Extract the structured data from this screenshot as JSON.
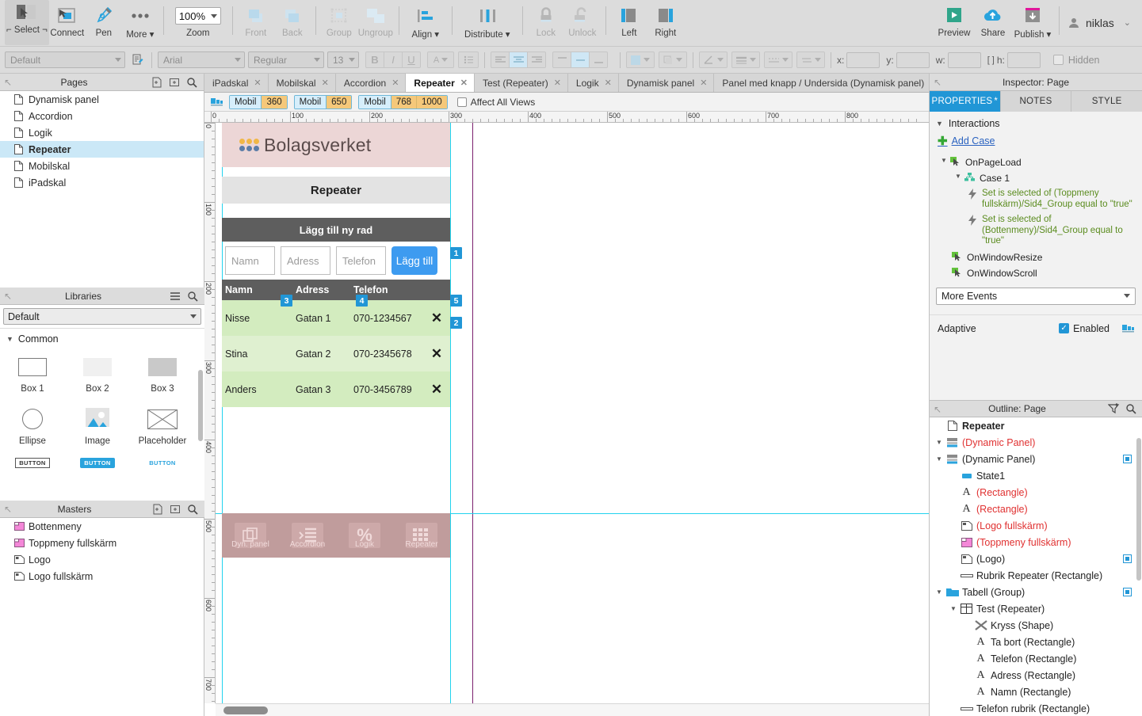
{
  "toolbar": {
    "items": [
      {
        "label": "Select",
        "name": "select-tool",
        "enabled": true
      },
      {
        "label": "Connect",
        "name": "connect-tool",
        "enabled": true
      },
      {
        "label": "Pen",
        "name": "pen-tool",
        "enabled": true
      },
      {
        "label": "More ▾",
        "name": "more-tool",
        "enabled": true
      }
    ],
    "zoom_value": "100%",
    "zoom_label": "Zoom",
    "order": [
      {
        "label": "Front",
        "name": "bring-front-button",
        "enabled": false
      },
      {
        "label": "Back",
        "name": "send-back-button",
        "enabled": false
      }
    ],
    "grouping": [
      {
        "label": "Group",
        "name": "group-button",
        "enabled": false
      },
      {
        "label": "Ungroup",
        "name": "ungroup-button",
        "enabled": false
      }
    ],
    "arrange": [
      {
        "label": "Align ▾",
        "name": "align-button",
        "enabled": true
      },
      {
        "label": "Distribute ▾",
        "name": "distribute-button",
        "enabled": true
      }
    ],
    "locking": [
      {
        "label": "Lock",
        "name": "lock-button",
        "enabled": false
      },
      {
        "label": "Unlock",
        "name": "unlock-button",
        "enabled": false
      }
    ],
    "pinning": [
      {
        "label": "Left",
        "name": "pin-left-button",
        "enabled": true
      },
      {
        "label": "Right",
        "name": "pin-right-button",
        "enabled": true
      }
    ],
    "publish": [
      {
        "label": "Preview",
        "name": "preview-button"
      },
      {
        "label": "Share",
        "name": "share-button"
      },
      {
        "label": "Publish ▾",
        "name": "publish-button"
      }
    ],
    "account": "niklas"
  },
  "formatbar": {
    "style": "Default",
    "font": "Arial",
    "weight": "Regular",
    "size": "13",
    "x_label": "x:",
    "y_label": "y:",
    "w_label": "w:",
    "h_label": "h:",
    "x_value": "",
    "y_value": "",
    "w_value": "",
    "h_value": "",
    "hidden_label": "Hidden"
  },
  "pages": {
    "title": "Pages",
    "items": [
      {
        "label": "Dynamisk panel",
        "selected": false
      },
      {
        "label": "Accordion",
        "selected": false
      },
      {
        "label": "Logik",
        "selected": false
      },
      {
        "label": "Repeater",
        "selected": true
      },
      {
        "label": "Mobilskal",
        "selected": false
      },
      {
        "label": "iPadskal",
        "selected": false
      }
    ]
  },
  "libraries": {
    "title": "Libraries",
    "selected": "Default",
    "category": "Common",
    "widgets": [
      {
        "label": "Box 1",
        "icon": "box-outline-icon"
      },
      {
        "label": "Box 2",
        "icon": "box-light-icon"
      },
      {
        "label": "Box 3",
        "icon": "box-grey-icon"
      },
      {
        "label": "Ellipse",
        "icon": "ellipse-icon"
      },
      {
        "label": "Image",
        "icon": "image-icon"
      },
      {
        "label": "Placeholder",
        "icon": "placeholder-icon"
      },
      {
        "label": "BUTTON",
        "icon": "button-outline-icon"
      },
      {
        "label": "BUTTON",
        "icon": "button-filled-icon"
      },
      {
        "label": "BUTTON",
        "icon": "button-link-icon"
      }
    ]
  },
  "masters": {
    "title": "Masters",
    "items": [
      {
        "label": "Bottenmeny",
        "icon": "master-pink-icon"
      },
      {
        "label": "Toppmeny fullskärm",
        "icon": "master-pink-icon"
      },
      {
        "label": "Logo",
        "icon": "master-grey-icon"
      },
      {
        "label": "Logo fullskärm",
        "icon": "master-grey-icon"
      }
    ]
  },
  "tabs": [
    {
      "label": "iPadskal",
      "active": false
    },
    {
      "label": "Mobilskal",
      "active": false
    },
    {
      "label": "Accordion",
      "active": false
    },
    {
      "label": "Repeater",
      "active": true
    },
    {
      "label": "Test (Repeater)",
      "active": false
    },
    {
      "label": "Logik",
      "active": false
    },
    {
      "label": "Dynamisk panel",
      "active": false
    },
    {
      "label": "Panel med knapp / Undersida (Dynamisk panel)",
      "active": false
    }
  ],
  "adaptive_bar": {
    "views": [
      {
        "name": "Mobil",
        "width": "360"
      },
      {
        "name": "Mobil",
        "width": "650"
      },
      {
        "name": "Mobil",
        "width": "768",
        "width2": "1000"
      }
    ],
    "affect_all_label": "Affect All Views",
    "affect_all_checked": false
  },
  "ruler": {
    "top_marks": [
      "0",
      "100",
      "200",
      "300",
      "400",
      "500",
      "600",
      "700",
      "800"
    ],
    "left_marks": [
      "0",
      "100",
      "200",
      "300",
      "400",
      "500",
      "600",
      "700"
    ]
  },
  "guides": {
    "vertical_cyan": [
      "left",
      "right"
    ],
    "vertical_purple": "page-boundary",
    "horizontal_cyan": "fold-line"
  },
  "prototype": {
    "logo_text": "Bolagsverket",
    "logo_dot_colors": [
      "#f0b747",
      "#f0b747",
      "#f0b747",
      "#5b7da8",
      "#5b7da8",
      "#5b7da8"
    ],
    "heading": "Repeater",
    "add_bar_title": "Lägg till ny rad",
    "inputs": [
      {
        "placeholder": "Namn",
        "value": ""
      },
      {
        "placeholder": "Adress",
        "value": ""
      },
      {
        "placeholder": "Telefon",
        "value": ""
      }
    ],
    "add_button": "Lägg till",
    "table": {
      "headers": [
        "Namn",
        "Adress",
        "Telefon",
        ""
      ],
      "rows": [
        {
          "namn": "Nisse",
          "adress": "Gatan 1",
          "telefon": "070-1234567",
          "action": "✕"
        },
        {
          "namn": "Stina",
          "adress": "Gatan 2",
          "telefon": "070-2345678",
          "action": "✕"
        },
        {
          "namn": "Anders",
          "adress": "Gatan 3",
          "telefon": "070-3456789",
          "action": "✕"
        }
      ]
    },
    "badges": [
      "1",
      "2",
      "3",
      "4",
      "5"
    ],
    "bottom_menu": [
      {
        "label": "Dyn. panel",
        "icon": "copy-icon"
      },
      {
        "label": "Accordion",
        "icon": "list-icon"
      },
      {
        "label": "Logik",
        "icon": "percent-icon"
      },
      {
        "label": "Repeater",
        "icon": "grid-icon"
      }
    ]
  },
  "inspector": {
    "title": "Inspector: Page",
    "tabs": [
      {
        "label": "PROPERTIES",
        "active": true
      },
      {
        "label": "NOTES",
        "active": false
      },
      {
        "label": "STYLE",
        "active": false
      }
    ],
    "section": "Interactions",
    "add_case": "Add Case",
    "events": [
      {
        "name": "OnPageLoad",
        "cases": [
          {
            "name": "Case 1",
            "actions": [
              "Set is selected of (Toppmeny fullskärm)/Sid4_Group equal to \"true\"",
              "Set is selected of (Bottenmeny)/Sid4_Group equal to \"true\""
            ]
          }
        ]
      },
      {
        "name": "OnWindowResize",
        "cases": []
      },
      {
        "name": "OnWindowScroll",
        "cases": []
      }
    ],
    "more_events": "More Events",
    "adaptive_label": "Adaptive",
    "enabled_label": "Enabled",
    "enabled_checked": true
  },
  "outline": {
    "title": "Outline: Page",
    "items": [
      {
        "label": "Repeater",
        "depth": 0,
        "icon": "page-icon",
        "red": false,
        "bold": true,
        "arrow": "",
        "square": false
      },
      {
        "label": "(Dynamic Panel)",
        "depth": 0,
        "icon": "dynamic-panel-icon",
        "red": true,
        "bold": false,
        "arrow": "▼",
        "square": false
      },
      {
        "label": "(Dynamic Panel)",
        "depth": 0,
        "icon": "dynamic-panel-icon",
        "red": false,
        "bold": false,
        "arrow": "▼",
        "square": true
      },
      {
        "label": "State1",
        "depth": 1,
        "icon": "state-icon",
        "red": false,
        "bold": false,
        "arrow": "",
        "square": false
      },
      {
        "label": "(Rectangle)",
        "depth": 1,
        "icon": "text-icon",
        "red": true,
        "bold": false,
        "arrow": "",
        "square": false
      },
      {
        "label": "(Rectangle)",
        "depth": 1,
        "icon": "text-icon",
        "red": true,
        "bold": false,
        "arrow": "",
        "square": false
      },
      {
        "label": "(Logo fullskärm)",
        "depth": 1,
        "icon": "master-grey-icon",
        "red": true,
        "bold": false,
        "arrow": "",
        "square": false
      },
      {
        "label": "(Toppmeny fullskärm)",
        "depth": 1,
        "icon": "master-pink-icon",
        "red": true,
        "bold": false,
        "arrow": "",
        "square": false
      },
      {
        "label": "(Logo)",
        "depth": 1,
        "icon": "master-grey-icon",
        "red": false,
        "bold": false,
        "arrow": "",
        "square": true
      },
      {
        "label": "Rubrik Repeater (Rectangle)",
        "depth": 1,
        "icon": "rect-icon",
        "red": false,
        "bold": false,
        "arrow": "",
        "square": false
      },
      {
        "label": "Tabell (Group)",
        "depth": 0,
        "icon": "folder-icon",
        "red": false,
        "bold": false,
        "arrow": "▼",
        "square": true
      },
      {
        "label": "Test (Repeater)",
        "depth": 1,
        "icon": "repeater-icon",
        "red": false,
        "bold": false,
        "arrow": "▼",
        "square": false
      },
      {
        "label": "Kryss (Shape)",
        "depth": 2,
        "icon": "shape-x-icon",
        "red": false,
        "bold": false,
        "arrow": "",
        "square": false
      },
      {
        "label": "Ta bort (Rectangle)",
        "depth": 2,
        "icon": "text-icon",
        "red": false,
        "bold": false,
        "arrow": "",
        "square": false
      },
      {
        "label": "Telefon (Rectangle)",
        "depth": 2,
        "icon": "text-icon",
        "red": false,
        "bold": false,
        "arrow": "",
        "square": false
      },
      {
        "label": "Adress (Rectangle)",
        "depth": 2,
        "icon": "text-icon",
        "red": false,
        "bold": false,
        "arrow": "",
        "square": false
      },
      {
        "label": "Namn (Rectangle)",
        "depth": 2,
        "icon": "text-icon",
        "red": false,
        "bold": false,
        "arrow": "",
        "square": false
      },
      {
        "label": "Telefon rubrik (Rectangle)",
        "depth": 1,
        "icon": "rect-icon",
        "red": false,
        "bold": false,
        "arrow": "",
        "square": false
      }
    ]
  },
  "colors": {
    "accent_blue": "#2196d6",
    "button_blue": "#3d9bf0",
    "table_row_dark": "#d3ecbf",
    "table_row_light": "#dff0d0",
    "header_grey": "#5e5e5e",
    "logo_band": "#ecd6d6",
    "action_green": "#5b8c1f",
    "outline_red": "#e03131"
  }
}
